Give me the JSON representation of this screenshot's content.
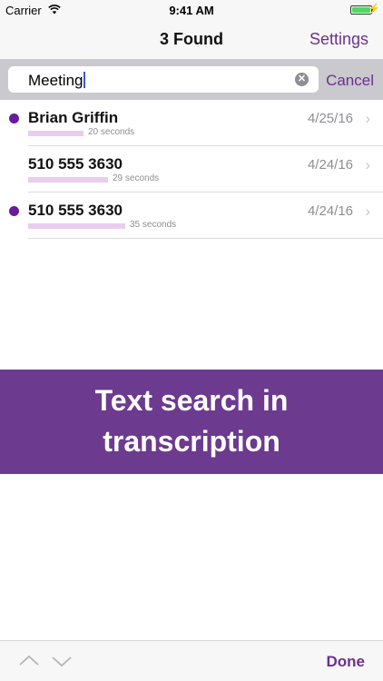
{
  "status": {
    "carrier": "Carrier",
    "time": "9:41 AM"
  },
  "nav": {
    "title": "3 Found",
    "settings": "Settings"
  },
  "search": {
    "query": "Meeting",
    "cancel": "Cancel"
  },
  "results": [
    {
      "name": "Brian Griffin",
      "duration": "20 seconds",
      "date": "4/25/16",
      "unread": true,
      "duration_seconds": 20
    },
    {
      "name": "510 555 3630",
      "duration": "29 seconds",
      "date": "4/24/16",
      "unread": false,
      "duration_seconds": 29
    },
    {
      "name": "510 555 3630",
      "duration": "35 seconds",
      "date": "4/24/16",
      "unread": true,
      "duration_seconds": 35
    }
  ],
  "banner": {
    "line1": "Text search in",
    "line2": "transcription"
  },
  "toolbar": {
    "done": "Done",
    "icons": [
      "chevron-up-icon",
      "chevron-down-icon"
    ]
  },
  "colors": {
    "accent": "#6e2f8e",
    "banner": "#6c3a8e",
    "unread_dot": "#6a1a9a",
    "duration_bar": "#e8cdf1"
  }
}
